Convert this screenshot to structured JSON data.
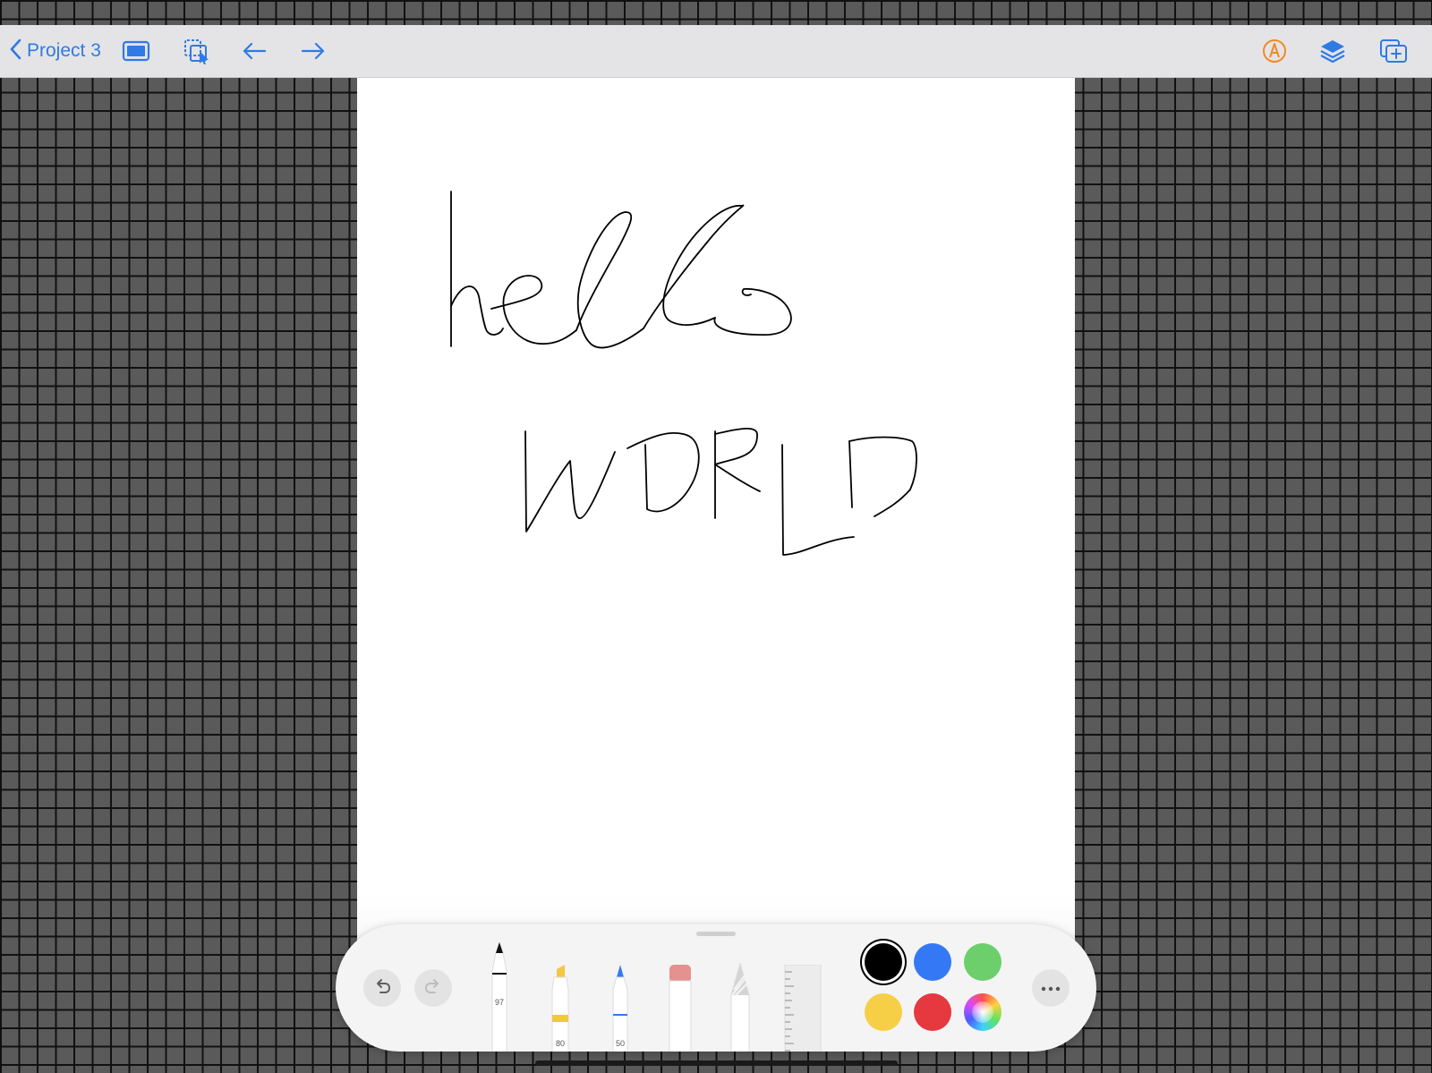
{
  "toolbar": {
    "back_label": "Project 3",
    "icons": [
      "chevron-left-icon",
      "fullscreen-icon",
      "selection-icon",
      "undo-arrow-icon",
      "redo-arrow-icon",
      "pencil-circle-icon",
      "layers-icon",
      "add-page-icon"
    ],
    "accent_color": "#2f7ae5",
    "pencil_color": "#f08a24"
  },
  "canvas": {
    "background": "#ffffff",
    "strokes": [
      "hello",
      "WORLD"
    ],
    "stroke_color": "#000000"
  },
  "palette": {
    "tools": [
      {
        "name": "pen",
        "width_label": "97"
      },
      {
        "name": "marker",
        "width_label": "80"
      },
      {
        "name": "fineliner",
        "width_label": "50"
      },
      {
        "name": "eraser"
      },
      {
        "name": "pencil"
      },
      {
        "name": "ruler"
      }
    ],
    "colors": [
      "#000000",
      "#3478f6",
      "#6ccf6b",
      "#f7cf46",
      "#e5383f",
      "color-wheel"
    ],
    "selected_color": "#000000"
  }
}
